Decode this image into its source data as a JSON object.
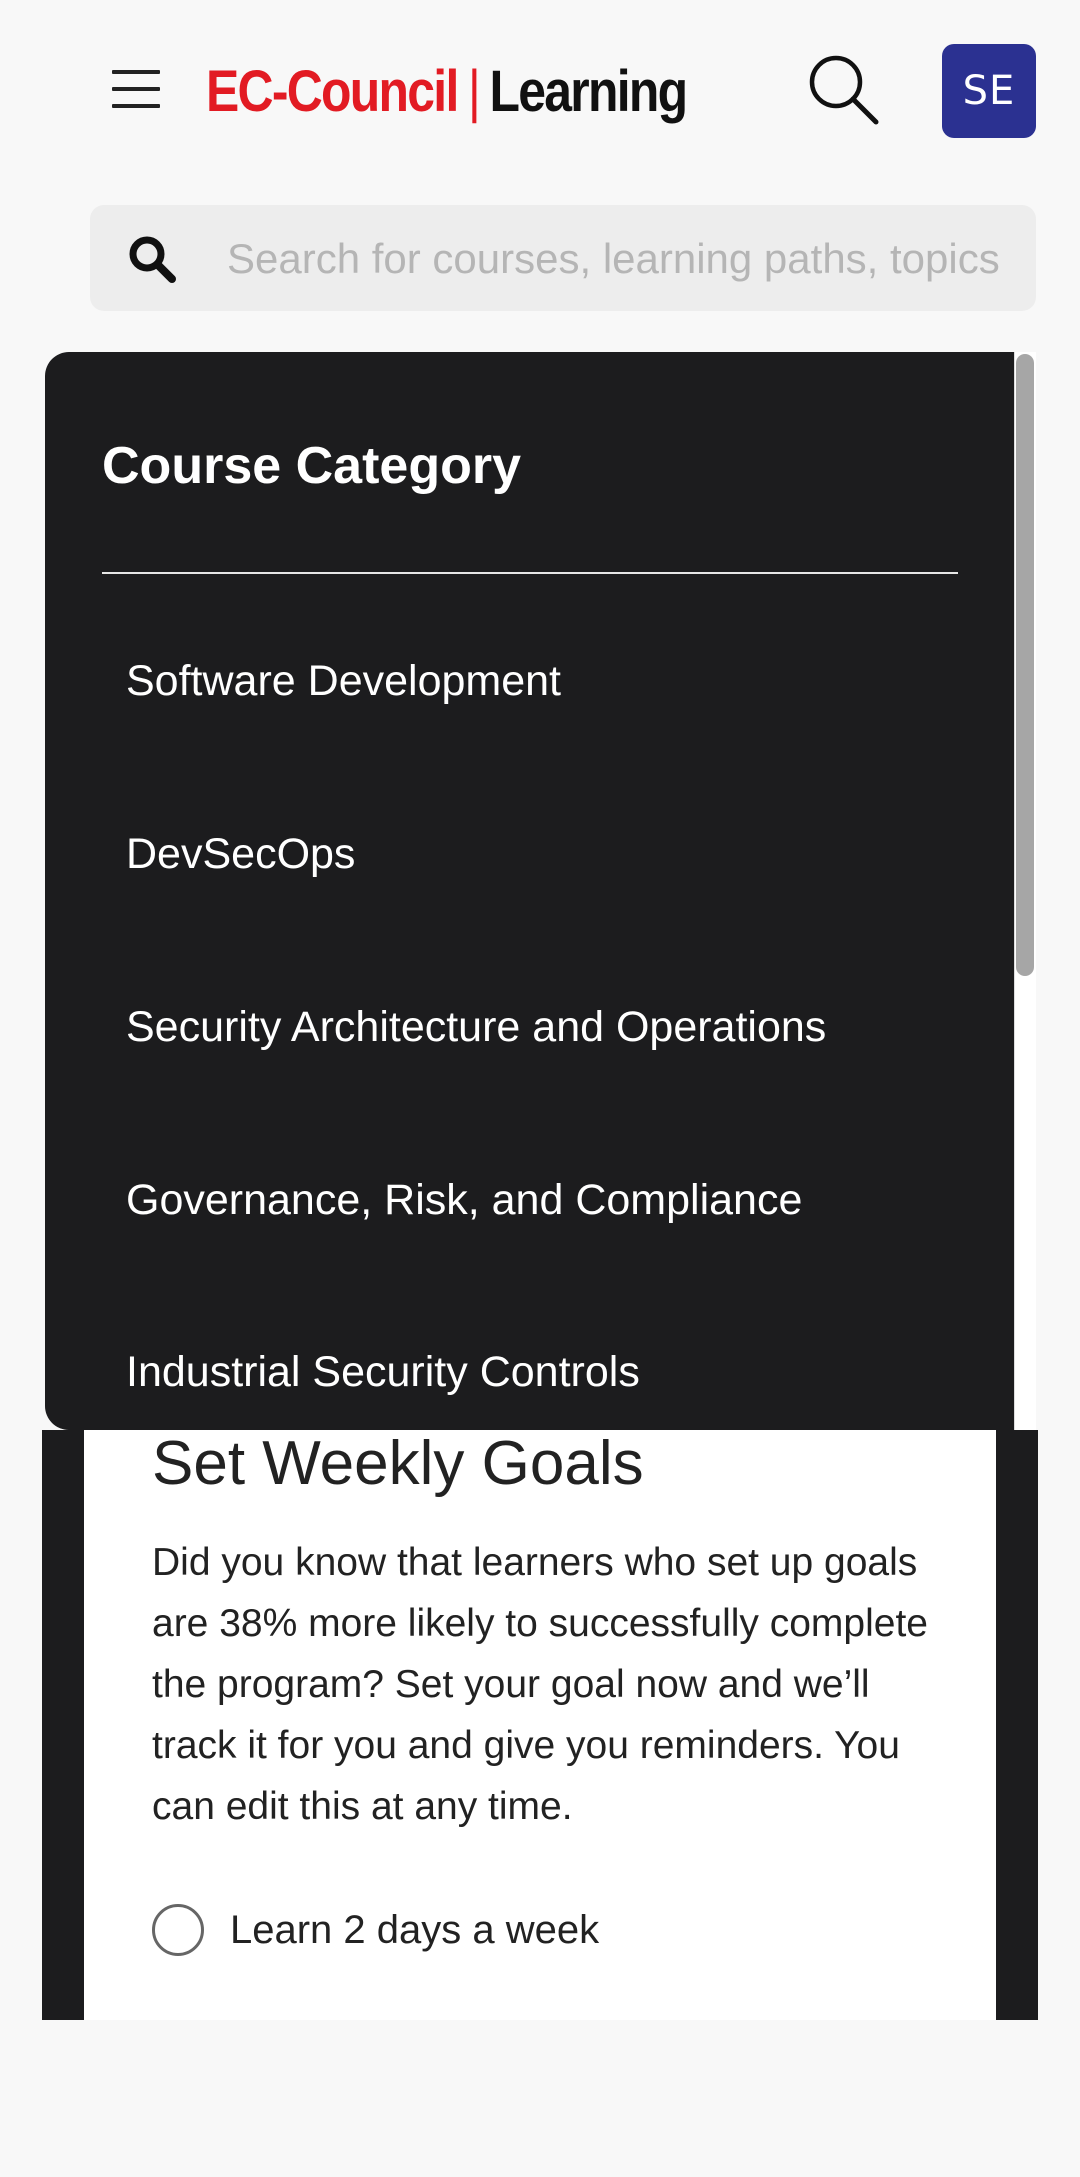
{
  "header": {
    "logo_brand": "EC-Council",
    "logo_separator": "|",
    "logo_product": "Learning",
    "avatar_initials": "SE",
    "menu_icon": "hamburger-icon",
    "search_icon": "search-icon"
  },
  "search": {
    "placeholder": "Search for courses, learning paths, topics",
    "value": ""
  },
  "dropdown": {
    "title": "Course Category",
    "items": [
      "Software Development",
      "DevSecOps",
      "Security Architecture and Operations",
      "Governance, Risk, and Compliance",
      "Industrial Security Controls"
    ]
  },
  "goals": {
    "title": "Set Weekly Goals",
    "description": "Did you know that learners who set up goals are 38% more likely to successfully complete the program? Set your goal now and we’ll track it for you and give you reminders. You can edit this at any time.",
    "options": [
      "Learn 2 days a week"
    ]
  },
  "colors": {
    "brand_red": "#e21b23",
    "avatar_bg": "#2b3191",
    "dropdown_bg": "#1c1c1e"
  }
}
